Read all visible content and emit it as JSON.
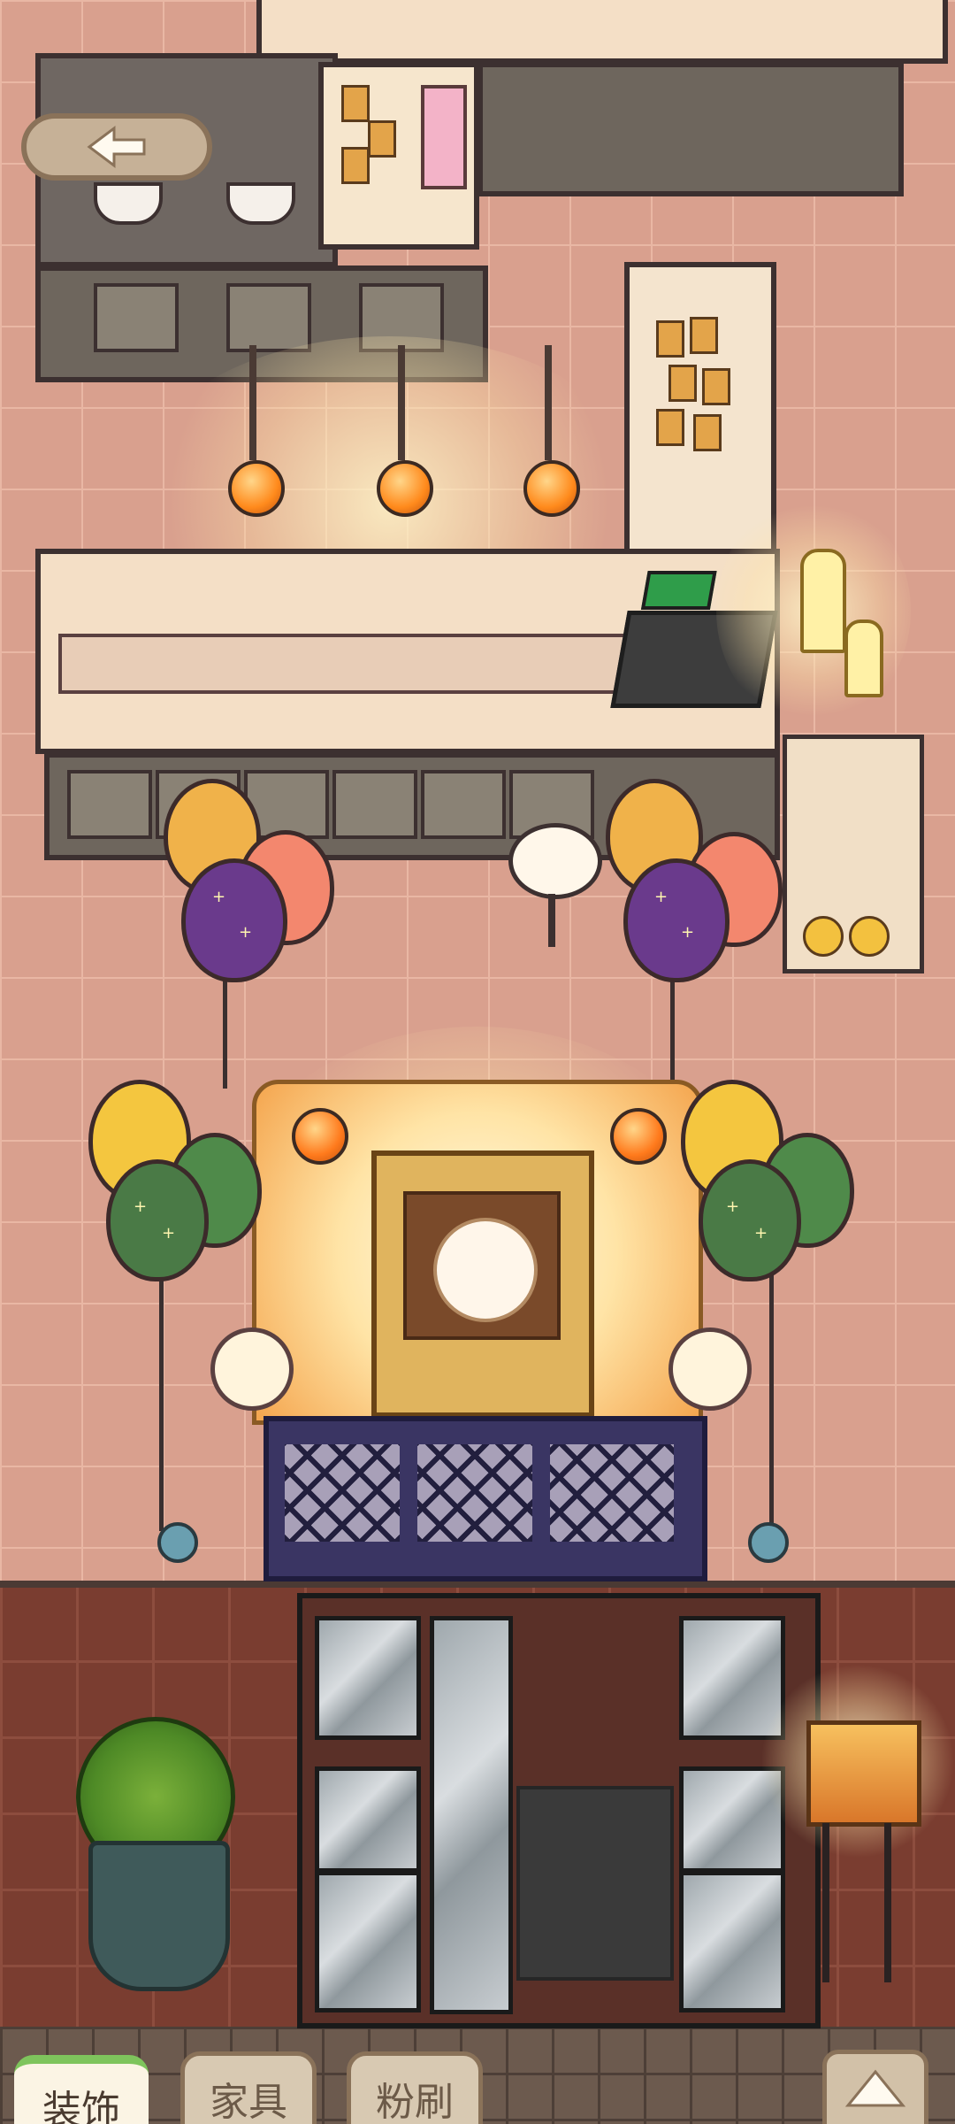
{
  "ui": {
    "back_icon": "left-arrow-icon",
    "expand_icon": "up-triangle-icon"
  },
  "bottom_tabs": [
    {
      "label": "装饰",
      "active": true
    },
    {
      "label": "家具",
      "active": false
    },
    {
      "label": "粉刷",
      "active": false
    }
  ],
  "colors": {
    "upper_floor": "#d9a08e",
    "lower_floor": "#7a3d30",
    "active_tab_accent": "#7ec45c",
    "tab_background": "#fbf4e4"
  }
}
